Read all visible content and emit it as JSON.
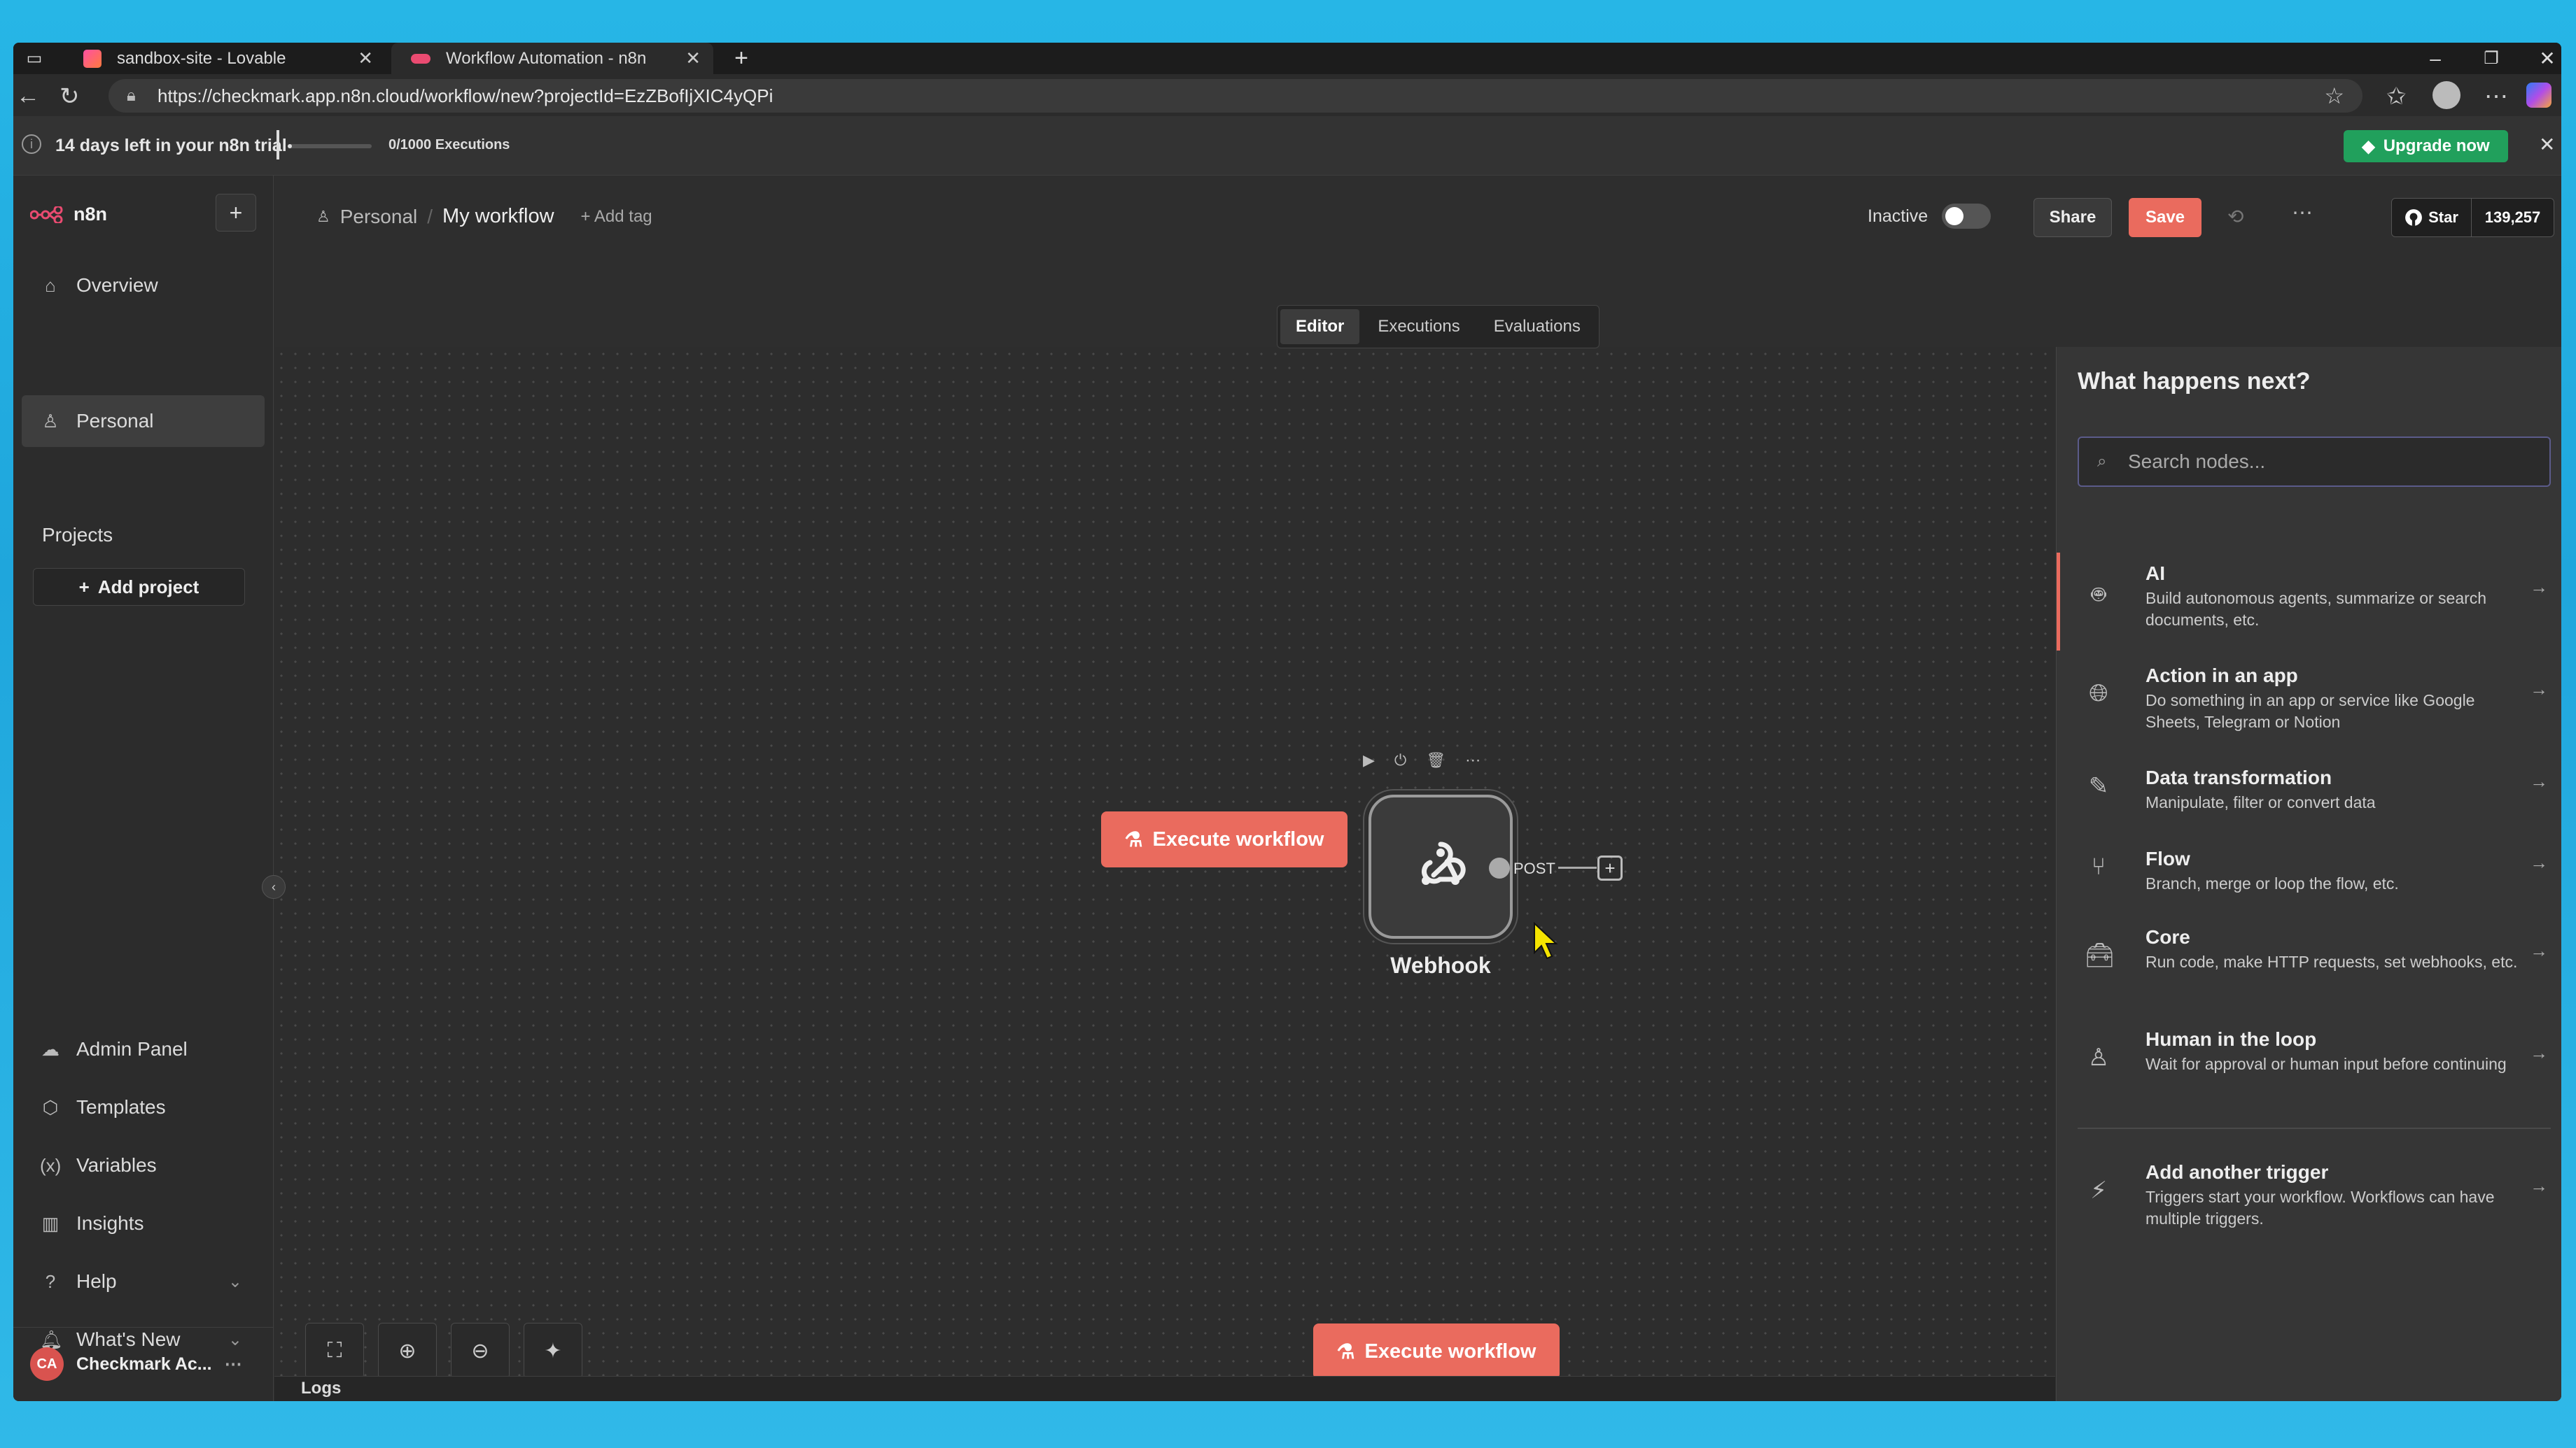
{
  "browser": {
    "tabs": [
      {
        "title": "sandbox-site - Lovable",
        "active": false
      },
      {
        "title": "Workflow Automation - n8n",
        "active": true
      }
    ],
    "url": "https://checkmark.app.n8n.cloud/workflow/new?projectId=EzZBofIjXIC4yQPi"
  },
  "trial": {
    "text": "14 days left in your n8n trial",
    "executions": "0/1000 Executions",
    "usage_fraction": 0.0,
    "upgrade_label": "Upgrade now"
  },
  "sidebar": {
    "brand": "n8n",
    "items_top": [
      {
        "label": "Overview",
        "icon": "home-icon"
      },
      {
        "label": "Personal",
        "icon": "user-icon",
        "active": true
      }
    ],
    "projects_label": "Projects",
    "add_project_label": "Add project",
    "items_bottom": [
      {
        "label": "Admin Panel",
        "icon": "cloud-icon"
      },
      {
        "label": "Templates",
        "icon": "template-icon"
      },
      {
        "label": "Variables",
        "icon": "variables-icon"
      },
      {
        "label": "Insights",
        "icon": "insights-icon"
      },
      {
        "label": "Help",
        "icon": "help-icon"
      },
      {
        "label": "What's New",
        "icon": "bell-icon"
      }
    ],
    "user": {
      "initials": "CA",
      "name": "Checkmark Ac..."
    }
  },
  "header": {
    "breadcrumb_project": "Personal",
    "workflow_name": "My workflow",
    "add_tag": "+ Add tag",
    "status": "Inactive",
    "share_label": "Share",
    "save_label": "Save",
    "github_star_label": "Star",
    "github_stars": "139,257"
  },
  "canvas": {
    "tabs": [
      "Editor",
      "Executions",
      "Evaluations"
    ],
    "active_tab": "Editor",
    "execute_label": "Execute workflow",
    "node": {
      "name": "Webhook",
      "output_label": "POST"
    },
    "logs_label": "Logs"
  },
  "panel": {
    "title": "What happens next?",
    "search_placeholder": "Search nodes...",
    "categories": [
      {
        "name": "AI",
        "desc": "Build autonomous agents, summarize or search documents, etc.",
        "icon": "robot-icon"
      },
      {
        "name": "Action in an app",
        "desc": "Do something in an app or service like Google Sheets, Telegram or Notion",
        "icon": "globe-icon"
      },
      {
        "name": "Data transformation",
        "desc": "Manipulate, filter or convert data",
        "icon": "pen-icon"
      },
      {
        "name": "Flow",
        "desc": "Branch, merge or loop the flow, etc.",
        "icon": "branch-icon"
      },
      {
        "name": "Core",
        "desc": "Run code, make HTTP requests, set webhooks, etc.",
        "icon": "toolbox-icon"
      },
      {
        "name": "Human in the loop",
        "desc": "Wait for approval or human input before continuing",
        "icon": "person-check-icon"
      }
    ],
    "trigger": {
      "name": "Add another trigger",
      "desc": "Triggers start your workflow. Workflows can have multiple triggers.",
      "icon": "bolt-icon"
    }
  },
  "colors": {
    "accent": "#ea6b5e",
    "upgrade": "#21a05c"
  }
}
